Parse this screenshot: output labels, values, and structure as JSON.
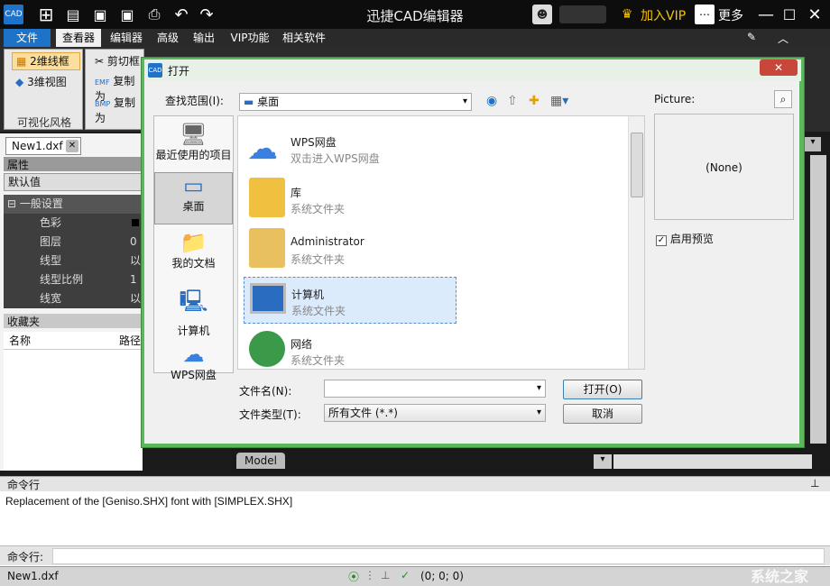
{
  "app": {
    "title": "迅捷CAD编辑器",
    "vip_label": "加入VIP",
    "more_label": "更多"
  },
  "menu": {
    "items": [
      "文件",
      "查看器",
      "编辑器",
      "高级",
      "输出",
      "VIP功能",
      "相关软件"
    ]
  },
  "ribbon": {
    "view2d": "2维线框",
    "view3d": "3维视图",
    "group_label": "可视化风格",
    "clip": "剪切框",
    "copy1": "复制为",
    "copy2": "复制为"
  },
  "left": {
    "tab": "New1.dxf",
    "properties_header": "属性",
    "default_label": "默认值",
    "general_settings": "一般设置",
    "props": [
      {
        "name": "色彩",
        "val": ""
      },
      {
        "name": "图层",
        "val": "0"
      },
      {
        "name": "线型",
        "val": "以"
      },
      {
        "name": "线型比例",
        "val": "1"
      },
      {
        "name": "线宽",
        "val": "以"
      }
    ],
    "favorites_header": "收藏夹",
    "col_name": "名称",
    "col_path": "路径"
  },
  "dialog": {
    "title": "打开",
    "lookin_label": "查找范围(I):",
    "lookin_value": "桌面",
    "picture_label": "Picture:",
    "picture_value": "(None)",
    "preview_label": "启用预览",
    "places": [
      {
        "label": "最近使用的项目",
        "icon": "recent-items-icon"
      },
      {
        "label": "桌面",
        "icon": "desktop-icon"
      },
      {
        "label": "我的文档",
        "icon": "documents-icon"
      },
      {
        "label": "计算机",
        "icon": "computer-icon"
      },
      {
        "label": "WPS网盘",
        "icon": "cloud-icon"
      }
    ],
    "files": [
      {
        "name": "WPS网盘",
        "sub": "双击进入WPS网盘"
      },
      {
        "name": "库",
        "sub": "系统文件夹"
      },
      {
        "name": "Administrator",
        "sub": "系统文件夹"
      },
      {
        "name": "计算机",
        "sub": "系统文件夹"
      },
      {
        "name": "网络",
        "sub": "系统文件夹"
      }
    ],
    "filename_label": "文件名(N):",
    "filename_value": "",
    "filetype_label": "文件类型(T):",
    "filetype_value": "所有文件 (*.*)",
    "open_button": "打开(O)",
    "cancel_button": "取消"
  },
  "canvas": {
    "model_tab": "Model"
  },
  "cmd": {
    "header": "命令行",
    "output": "Replacement of the [Geniso.SHX] font with [SIMPLEX.SHX]",
    "prompt": "命令行:"
  },
  "status": {
    "file": "New1.dxf",
    "coords": "(0; 0; 0)"
  },
  "watermark": "系统之家"
}
